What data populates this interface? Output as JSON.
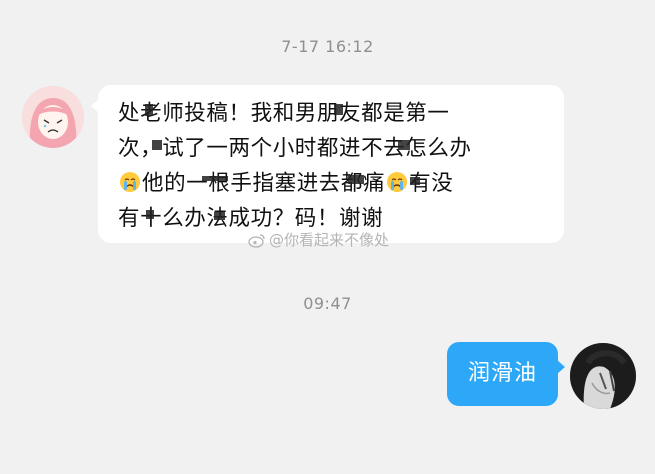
{
  "timestamps": {
    "first": "7-17 16:12",
    "second": "09:47"
  },
  "incoming": {
    "avatar": "pink-crying-girl-avatar",
    "lines": [
      "处老师投稿！我和男朋友都是第一",
      "次，试了一两个小时都进不去怎么办",
      "他的一根手指塞进去都痛",
      "有十么办法成功？码！谢谢"
    ],
    "line3_tail": "有没",
    "emoji": "crying-face-emoji"
  },
  "watermark": {
    "text": "@你看起来不像处",
    "icon": "weibo-icon"
  },
  "outgoing": {
    "text": "润滑油",
    "avatar": "dark-hair-avatar"
  },
  "colors": {
    "background": "#f1f1f1",
    "bubble_in": "#ffffff",
    "bubble_out": "#2da8f8",
    "timestamp": "#8f8f8f"
  }
}
